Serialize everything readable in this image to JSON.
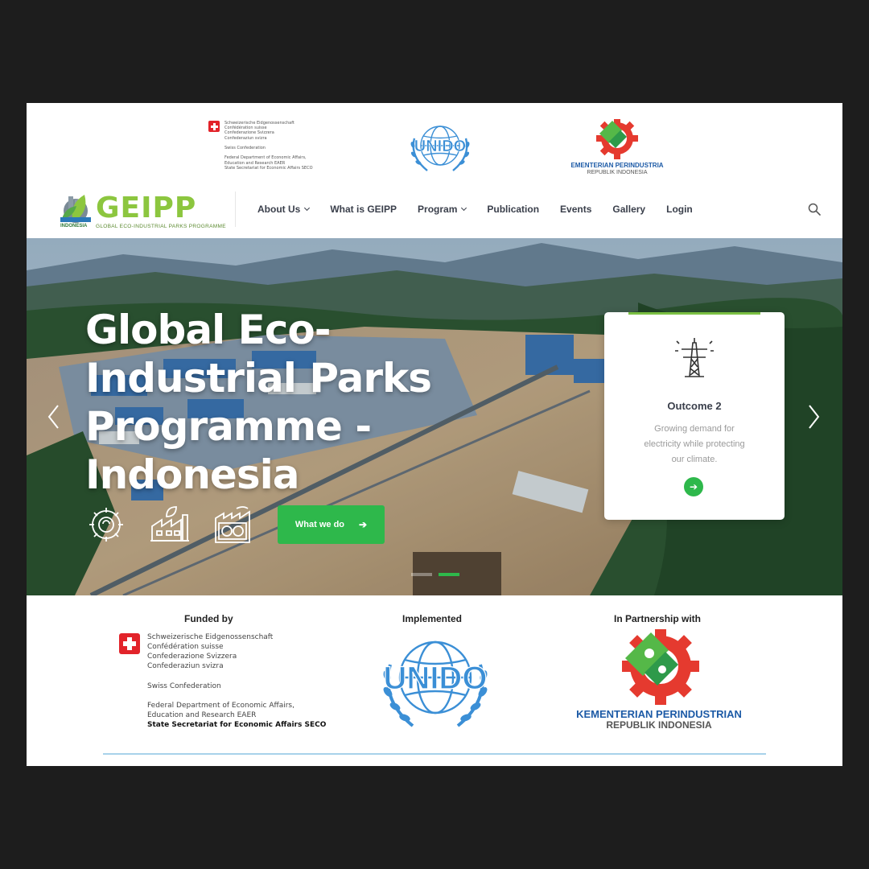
{
  "header": {
    "swiss_small_lines": [
      "Schweizerische Eidgenossenschaft",
      "Confédération suisse",
      "Confederazione Svizzera",
      "Confederaziun svizra",
      "",
      "Swiss Confederation",
      "",
      "Federal Department of Economic Affairs,",
      "Education and Research EAER",
      "State Secretariat for Economic Affairs SECO"
    ],
    "unido_text": "UNIDO",
    "kemen_line1": "KEMENTERIAN PERINDUSTRIAN",
    "kemen_line2": "REPUBLIK INDONESIA"
  },
  "nav": {
    "logo_word": "GEIPP",
    "logo_sub": "GLOBAL ECO-INDUSTRIAL PARKS PROGRAMME",
    "logo_country": "INDONESIA",
    "items": [
      {
        "label": "About Us",
        "dropdown": true
      },
      {
        "label": "What is GEIPP",
        "dropdown": false
      },
      {
        "label": "Program",
        "dropdown": true
      },
      {
        "label": "Publication",
        "dropdown": false
      },
      {
        "label": "Events",
        "dropdown": false
      },
      {
        "label": "Gallery",
        "dropdown": false
      },
      {
        "label": "Login",
        "dropdown": false
      }
    ]
  },
  "hero": {
    "title": "Global Eco-Industrial Parks Programme - Indonesia",
    "cta_label": "What we do",
    "cta_arrow": "➔",
    "slides": 2,
    "active_slide": 2,
    "outcome": {
      "title": "Outcome 2",
      "description": "Growing demand for electricity while protecting our climate.",
      "arrow": "➔"
    }
  },
  "partners": {
    "funded_by": "Funded by",
    "implemented": "Implemented",
    "partnership": "In Partnership with",
    "swiss_lines": [
      "Schweizerische Eidgenossenschaft",
      "Confédération suisse",
      "Confederazione Svizzera",
      "Confederaziun svizra",
      "Swiss Confederation",
      "Federal Department of Economic Affairs,",
      "Education and Research EAER",
      "State Secretariat for Economic Affairs SECO"
    ],
    "unido_text": "UNIDO",
    "kemen_line1": "KEMENTERIAN PERINDUSTRIAN",
    "kemen_line2": "REPUBLIK INDONESIA"
  },
  "colors": {
    "accent_green": "#2eb84b",
    "logo_green": "#8cc63f",
    "unido_blue": "#3b8fd6",
    "kemen_red": "#e53a2f",
    "kemen_blue": "#1c5aa6",
    "swiss_red": "#e2232a"
  }
}
